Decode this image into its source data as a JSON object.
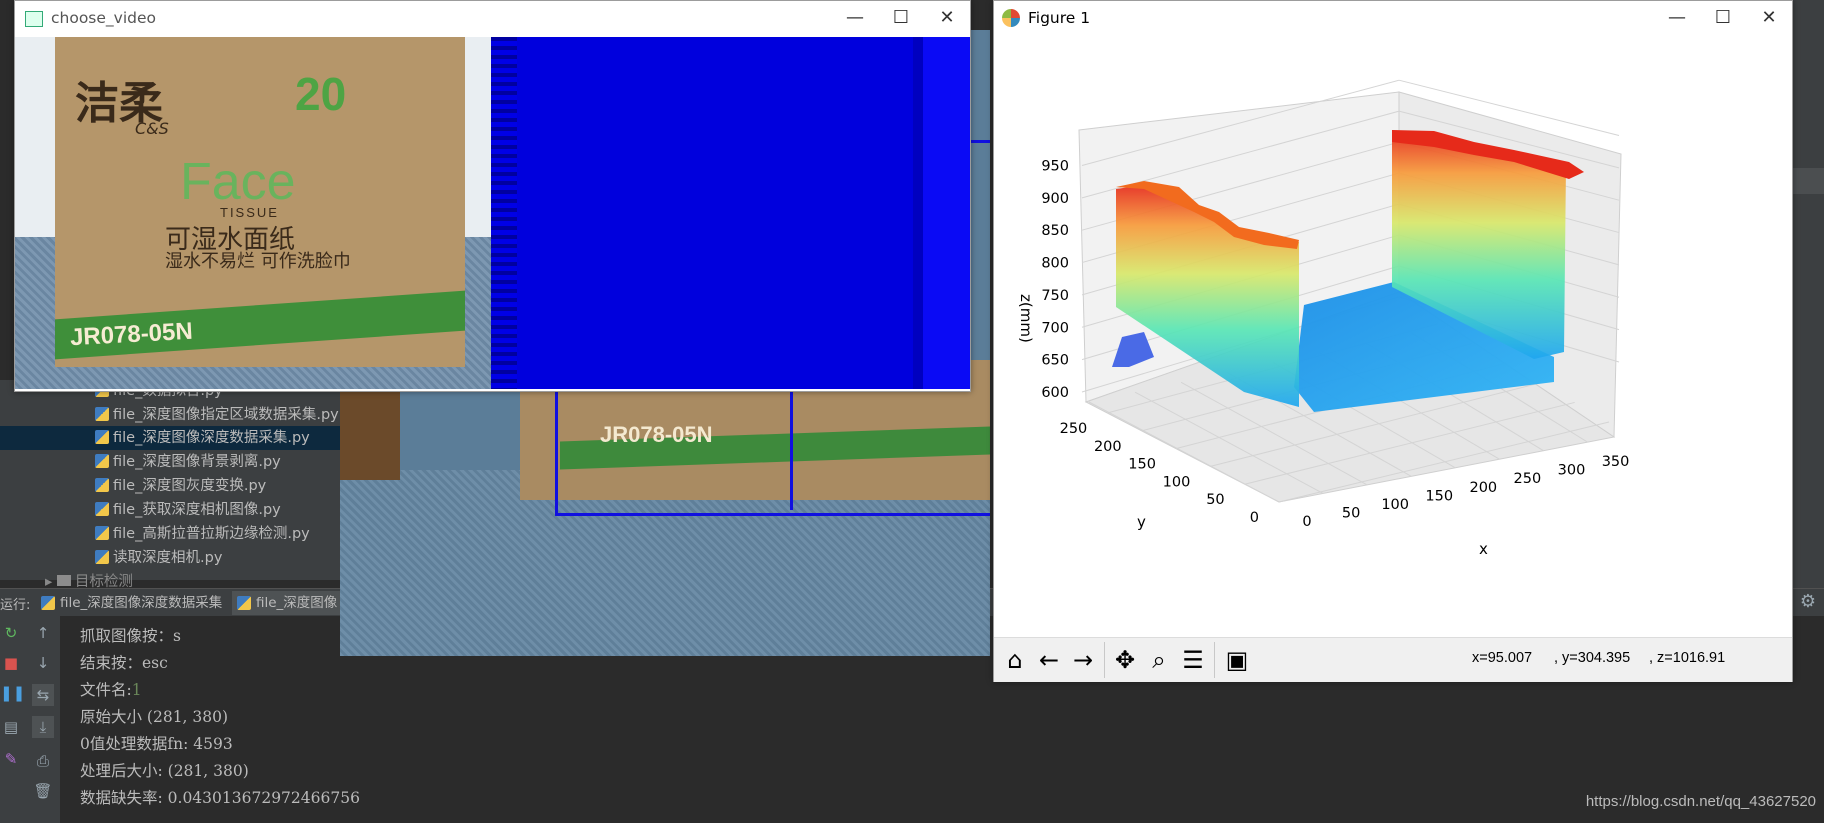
{
  "ide": {
    "project_files": [
      "file_数据拟合.py",
      "file_深度图像指定区域数据采集.py",
      "file_深度图像深度数据采集.py",
      "file_深度图像背景剥离.py",
      "file_深度图灰度变换.py",
      "file_获取深度相机图像.py",
      "file_高斯拉普拉斯边缘检测.py",
      "读取深度相机.py"
    ],
    "selected_file_index": 2,
    "folder": "目标检测",
    "run_label": "运行:",
    "run_tabs": [
      "file_深度图像深度数据采集",
      "file_深度图像"
    ],
    "active_run_tab": 1,
    "console_lines": [
      {
        "text": "  抓取图像按：s",
        "highlight": ""
      },
      {
        "text": "  结束按：esc",
        "highlight": ""
      },
      {
        "text": "文件名:",
        "highlight": "1"
      },
      {
        "text": "原始大小 (281, 380)",
        "highlight": ""
      },
      {
        "text": "0值处理数据fn:  4593",
        "highlight": ""
      },
      {
        "text": "处理后大小: (281, 380)",
        "highlight": ""
      },
      {
        "text": "数据缺失率:  0.043013672972466756",
        "highlight": ""
      }
    ],
    "watermark": "https://blog.csdn.net/qq_43627520"
  },
  "camera_under": {
    "box_code": "JR078-05N"
  },
  "choose_video": {
    "title": "choose_video",
    "box_brand": "洁柔",
    "box_brand_latin": "C&S",
    "box_count": "20",
    "box_face": "Face",
    "box_tissue": "TISSUE",
    "box_product": "可湿水面纸",
    "box_slogan": "湿水不易烂  可作洗脸巾",
    "box_code": "JR078-05N"
  },
  "figure": {
    "title": "Figure 1",
    "toolbar_icons": [
      "home-icon",
      "back-icon",
      "forward-icon",
      "pan-icon",
      "zoom-icon",
      "subplots-icon",
      "save-icon"
    ],
    "coords": {
      "x": "x=95.007",
      "y": ", y=304.395",
      "z": ", z=1016.91"
    }
  },
  "chart_data": {
    "type": "surface3d",
    "title": "",
    "xlabel": "x",
    "ylabel": "y",
    "zlabel": "z(mm)",
    "x_ticks": [
      "0",
      "50",
      "100",
      "150",
      "200",
      "250",
      "300",
      "350"
    ],
    "y_ticks": [
      "0",
      "50",
      "100",
      "150",
      "200",
      "250"
    ],
    "z_ticks": [
      "600",
      "650",
      "700",
      "750",
      "800",
      "850",
      "900",
      "950"
    ],
    "xlim": [
      0,
      380
    ],
    "ylim": [
      0,
      281
    ],
    "zlim": [
      600,
      960
    ],
    "colormap": "jet",
    "colormap_colors": [
      "#3b1fd6",
      "#1fa6f0",
      "#59e6b4",
      "#d8e86a",
      "#f79a3a",
      "#e62a1a"
    ],
    "grid": true
  }
}
